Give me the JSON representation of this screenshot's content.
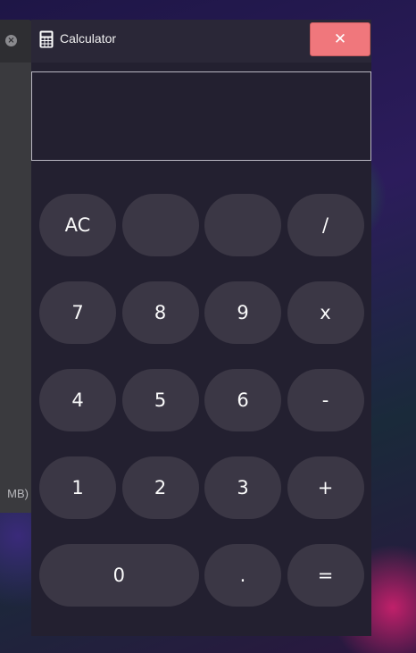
{
  "background_window": {
    "status_text": "MB)"
  },
  "window": {
    "title": "Calculator",
    "icon": "calculator-icon",
    "close_label": "✕"
  },
  "display": {
    "value": ""
  },
  "keypad": {
    "rows": [
      [
        {
          "label": "AC",
          "name": "clear-button"
        },
        {
          "label": "",
          "name": "blank-button-1"
        },
        {
          "label": "",
          "name": "blank-button-2"
        },
        {
          "label": "/",
          "name": "divide-button"
        }
      ],
      [
        {
          "label": "7",
          "name": "digit-7-button"
        },
        {
          "label": "8",
          "name": "digit-8-button"
        },
        {
          "label": "9",
          "name": "digit-9-button"
        },
        {
          "label": "x",
          "name": "multiply-button"
        }
      ],
      [
        {
          "label": "4",
          "name": "digit-4-button"
        },
        {
          "label": "5",
          "name": "digit-5-button"
        },
        {
          "label": "6",
          "name": "digit-6-button"
        },
        {
          "label": "-",
          "name": "subtract-button"
        }
      ],
      [
        {
          "label": "1",
          "name": "digit-1-button"
        },
        {
          "label": "2",
          "name": "digit-2-button"
        },
        {
          "label": "3",
          "name": "digit-3-button"
        },
        {
          "label": "+",
          "name": "add-button"
        }
      ],
      [
        {
          "label": "0",
          "name": "digit-0-button",
          "wide": true
        },
        {
          "label": ".",
          "name": "decimal-button"
        },
        {
          "label": "=",
          "name": "equals-button"
        }
      ]
    ]
  },
  "colors": {
    "window_bg": "#232030",
    "key_bg": "#3b3745",
    "close_button": "#f0777c"
  }
}
